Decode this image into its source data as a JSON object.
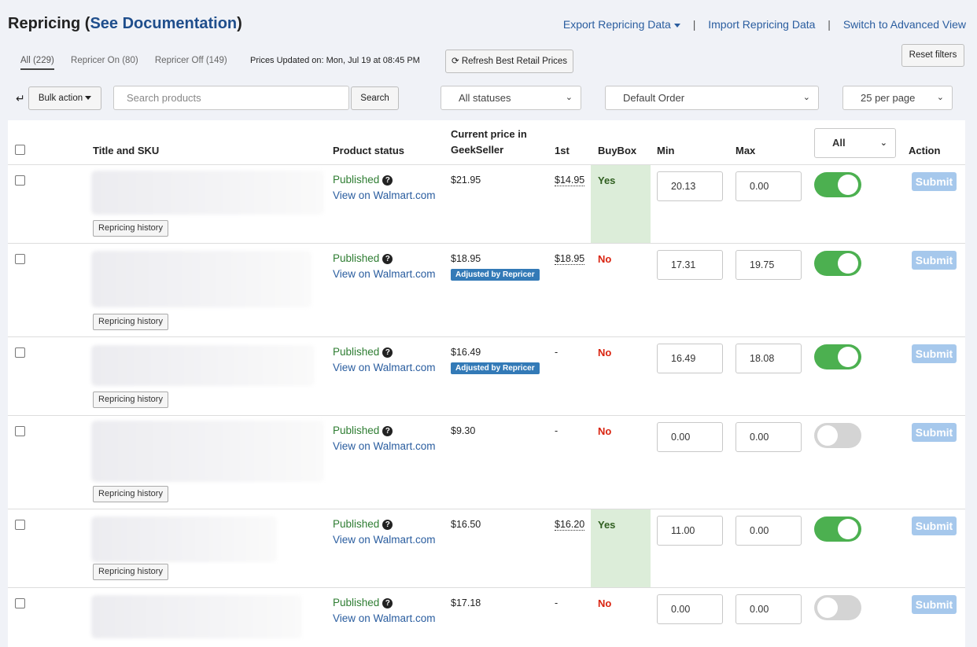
{
  "header": {
    "title_prefix": "Repricing (",
    "title_link": "See Documentation",
    "title_suffix": ")",
    "export_label": "Export Repricing Data",
    "import_label": "Import Repricing Data",
    "advanced_label": "Switch to Advanced View",
    "separator": "|"
  },
  "tabs": [
    {
      "label": "All (229)",
      "active": true
    },
    {
      "label": "Repricer On (80)",
      "active": false
    },
    {
      "label": "Repricer Off (149)",
      "active": false
    }
  ],
  "updated_text": "Prices Updated on: Mon, Jul 19 at 08:45 PM",
  "toolbar": {
    "refresh_label": "Refresh Best Retail Prices",
    "reset_label": "Reset filters",
    "bulk_label": "Bulk action",
    "search_placeholder": "Search products",
    "search_button": "Search",
    "status_select": "All statuses",
    "order_select": "Default Order",
    "perpage_select": "25 per page"
  },
  "table": {
    "headers": {
      "title": "Title and SKU",
      "status": "Product status",
      "price": "Current price in GeekSeller",
      "first": "1st",
      "buybox": "BuyBox",
      "min": "Min",
      "max": "Max",
      "filter": "All",
      "action": "Action"
    },
    "history_label": "Repricing history",
    "submit_label": "Submit",
    "view_label": "View on Walmart.com",
    "rows": [
      {
        "status": "Published",
        "price": "$21.95",
        "adjusted": false,
        "first": "$14.95",
        "buybox": "Yes",
        "min": "20.13",
        "max": "0.00",
        "enabled": true
      },
      {
        "status": "Published",
        "price": "$18.95",
        "adjusted": true,
        "adjusted_label": "Adjusted by Repricer",
        "first": "$18.95",
        "buybox": "No",
        "min": "17.31",
        "max": "19.75",
        "enabled": true
      },
      {
        "status": "Published",
        "price": "$16.49",
        "adjusted": true,
        "adjusted_label": "Adjusted by Repricer",
        "first": "-",
        "buybox": "No",
        "min": "16.49",
        "max": "18.08",
        "enabled": true
      },
      {
        "status": "Published",
        "price": "$9.30",
        "adjusted": false,
        "first": "-",
        "buybox": "No",
        "min": "0.00",
        "max": "0.00",
        "enabled": false
      },
      {
        "status": "Published",
        "price": "$16.50",
        "adjusted": false,
        "first": "$16.20",
        "buybox": "Yes",
        "min": "11.00",
        "max": "0.00",
        "enabled": true
      },
      {
        "status": "Published",
        "price": "$17.18",
        "adjusted": false,
        "first": "-",
        "buybox": "No",
        "min": "0.00",
        "max": "0.00",
        "enabled": false
      }
    ]
  }
}
